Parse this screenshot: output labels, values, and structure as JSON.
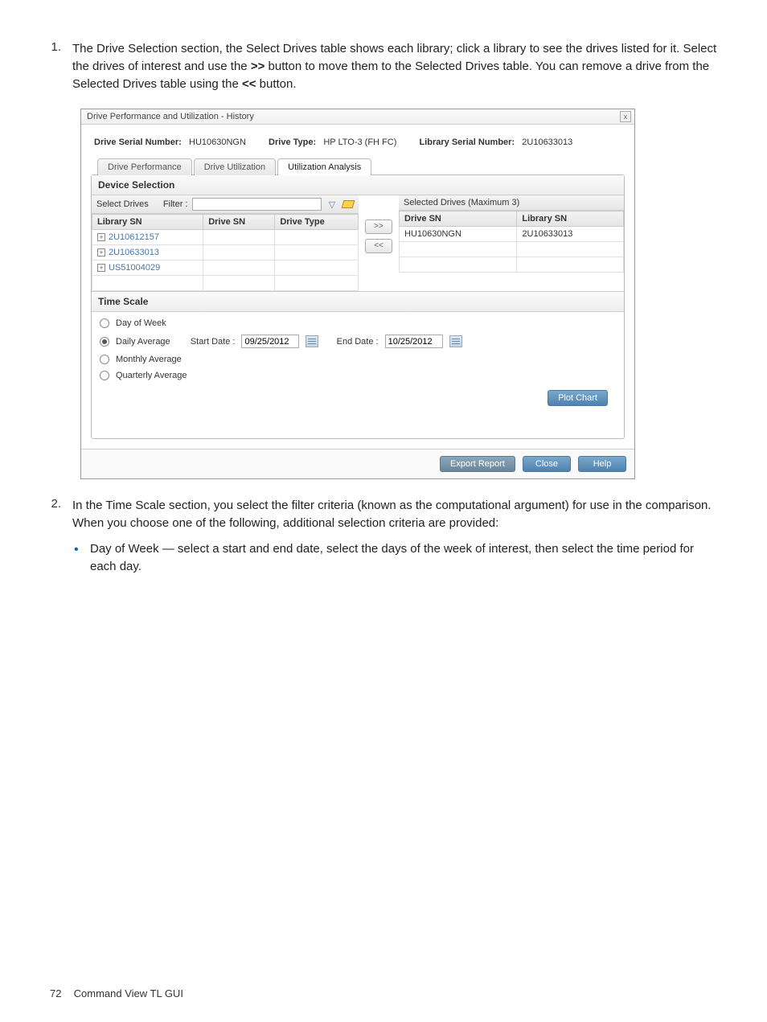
{
  "steps": {
    "s1": {
      "num": "1.",
      "text_a": "The Drive Selection section, the Select Drives table shows each library; click a library to see the drives listed for it. Select the drives of interest and use the ",
      "bold_a": ">>",
      "text_b": " button to move them to the Selected Drives table. You can remove a drive from the Selected Drives table using the ",
      "bold_b": "<<",
      "text_c": " button."
    },
    "s2": {
      "num": "2.",
      "text": "In the Time Scale section, you select the filter criteria (known as the computational argument) for use in the comparison. When you choose one of the following, additional selection criteria are provided:",
      "bullet1": "Day of Week — select a start and end date, select the days of the week of interest, then select the time period for each day."
    }
  },
  "shot": {
    "title": "Drive Performance and Utilization - History",
    "close": "x",
    "info": {
      "dsn_lbl": "Drive Serial Number:",
      "dsn_val": "HU10630NGN",
      "dt_lbl": "Drive Type:",
      "dt_val": "HP LTO-3 (FH FC)",
      "lsn_lbl": "Library Serial Number:",
      "lsn_val": "2U10633013"
    },
    "tabs": {
      "t1": "Drive Performance",
      "t2": "Drive Utilization",
      "t3": "Utilization Analysis"
    },
    "device_section": "Device Selection",
    "filter": {
      "lbl1": "Select Drives",
      "lbl2": "Filter :"
    },
    "left_headers": {
      "h1": "Library SN",
      "h2": "Drive SN",
      "h3": "Drive Type"
    },
    "left_rows": {
      "r1": "2U10612157",
      "r2": "2U10633013",
      "r3": "US51004029"
    },
    "move": {
      "add": ">>",
      "remove": "<<"
    },
    "sel_header": "Selected Drives (Maximum 3)",
    "right_headers": {
      "h1": "Drive SN",
      "h2": "Library SN"
    },
    "right_rows": {
      "r1c1": "HU10630NGN",
      "r1c2": "2U10633013"
    },
    "timescale": {
      "title": "Time Scale",
      "opt1": "Day of Week",
      "opt2": "Daily Average",
      "opt3": "Monthly Average",
      "opt4": "Quarterly Average",
      "start_lbl": "Start Date :",
      "start_val": "09/25/2012",
      "end_lbl": "End Date :",
      "end_val": "10/25/2012",
      "plot": "Plot Chart"
    },
    "footer": {
      "export": "Export Report",
      "close": "Close",
      "help": "Help"
    }
  },
  "page_footer": {
    "num": "72",
    "label": "Command View TL GUI"
  }
}
